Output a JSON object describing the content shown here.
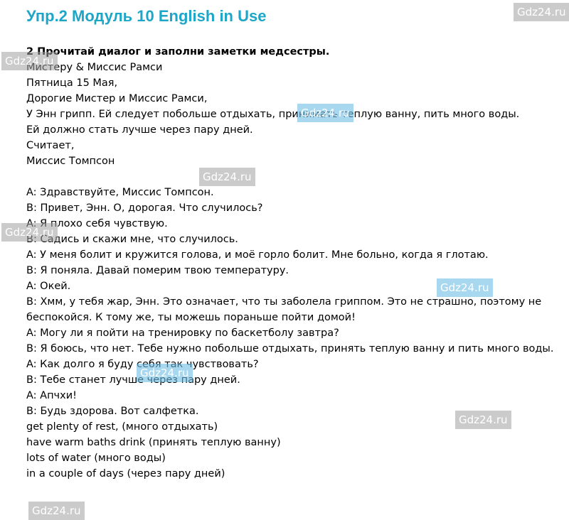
{
  "title": "Упр.2 Модуль 10 English in Use",
  "heading": "2 Прочитай диалог и заполни заметки медсестры.",
  "note": [
    "Мистеру & Миссис Рамси",
    "Пятница 15 Мая,",
    "Дорогие Мистер и Миссис Рамси,",
    "У Энн грипп. Ей следует побольше отдыхать, принимать теплую ванну, пить много воды.",
    "Ей должно стать лучше через пару дней.",
    "Считает,",
    "Миссис Томпсон"
  ],
  "dialogue": [
    "A: Здравствуйте, Миссис Томпсон.",
    "B: Привет, Энн. О, дорогая. Что случилось?",
    "A: Я плохо себя чувствую.",
    "B: Садись и скажи мне, что случилось.",
    "A: У меня болит и кружится голова, и моё горло болит. Мне больно, когда я глотаю.",
    "B: Я поняла. Давай померим твою температуру.",
    "A: Окей.",
    "B: Хмм, у тебя жар, Энн. Это означает, что ты заболела гриппом. Это не страшно, поэтому не беспокойся. К тому же, ты можешь пораньше пойти домой!",
    "A: Могу ли я пойти на тренировку по баскетболу завтра?",
    "B: Я боюсь, что нет. Тебе нужно побольше отдыхать, принять теплую ванну и пить много воды.",
    "A: Как долго я буду себя так чувствовать?",
    "B: Тебе станет лучше через пару дней.",
    "A: Апчхи!",
    "B: Будь здорова. Вот салфетка."
  ],
  "vocab": [
    "get plenty of rest, (много отдыхать)",
    "have warm baths drink (принять теплую ванну)",
    "lots of water (много воды)",
    "in a couple of days (через пару дней)"
  ],
  "watermark": "Gdz24.ru"
}
